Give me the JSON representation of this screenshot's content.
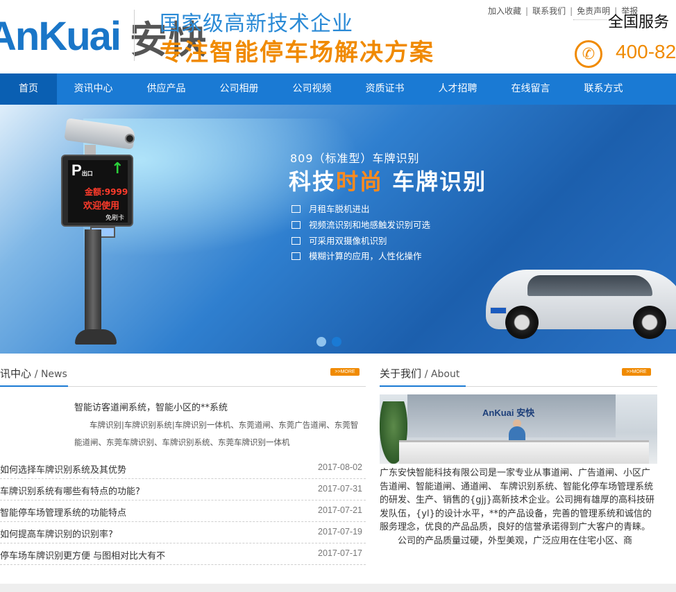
{
  "header": {
    "logo_en": "AnKuai",
    "logo_cn": "安快",
    "slogan_line1": "国家级高新技术企业",
    "slogan_line2": "专注智能停车场解决方案",
    "top_links": [
      "加入收藏",
      "联系我们",
      "免责声明",
      "举报"
    ],
    "service_label": "全国服务",
    "phone": "400-82"
  },
  "nav": {
    "items": [
      "首页",
      "资讯中心",
      "供应产品",
      "公司相册",
      "公司视频",
      "资质证书",
      "人才招聘",
      "在线留言",
      "联系方式"
    ],
    "active_index": 0
  },
  "banner": {
    "model": "809（标准型）车牌识别",
    "title_part1": "科技",
    "title_highlight": "时尚",
    "title_part2": "车牌识别",
    "features": [
      "月租车脱机进出",
      "视频流识别和地感触发识别可选",
      "可采用双摄像机识别",
      "模糊计算的应用，人性化操作"
    ],
    "gate_p": "P",
    "gate_exit": "出口",
    "gate_arrow": "↑",
    "gate_amount": "金额:9999",
    "gate_welcome": "欢迎使用",
    "gate_card": "免刷卡",
    "slides_total": 2,
    "active_slide": 2
  },
  "news": {
    "title_cn": "讯中心",
    "title_en": "/ News",
    "more": ">>MORE",
    "featured_title": "智能访客道闸系统，智能小区的**系统",
    "featured_desc": "车牌识别|车牌识别系统|车牌识别一体机、东莞道闸、东莞广告道闸、东莞智能道闸、东莞车牌识别、车牌识别系统、东莞车牌识别一体机",
    "items": [
      {
        "title": "如何选择车牌识别系统及其优势",
        "date": "2017-08-02"
      },
      {
        "title": "车牌识别系统有哪些有特点的功能?",
        "date": "2017-07-31"
      },
      {
        "title": "智能停车场管理系统的功能特点",
        "date": "2017-07-21"
      },
      {
        "title": "如何提高车牌识别的识别率?",
        "date": "2017-07-19"
      },
      {
        "title": "停车场车牌识别更方便 与图相对比大有不",
        "date": "2017-07-17"
      }
    ]
  },
  "about": {
    "title_cn": "关于我们",
    "title_en": "/ About",
    "more": ">>MORE",
    "image_logo": "AnKuai 安快",
    "text1": "广东安快智能科技有限公司是一家专业从事道闸、广告道闸、小区广告道闸、智能道闸、通道闸、 车牌识别系统、智能化停车场管理系统的研发、生产、销售的{gjj}高新技术企业。公司拥有雄厚的高科技研发队伍，{yl}的设计水平，**的产品设备，完善的管理系统和诚信的服务理念，优良的产品品质，良好的信誉承诺得到广大客户的青睐。",
    "text2": "公司的产品质量过硬，外型美观，广泛应用在住宅小区、商"
  },
  "colors": {
    "brand_blue": "#1a7ad4",
    "accent_orange": "#f08a00"
  }
}
